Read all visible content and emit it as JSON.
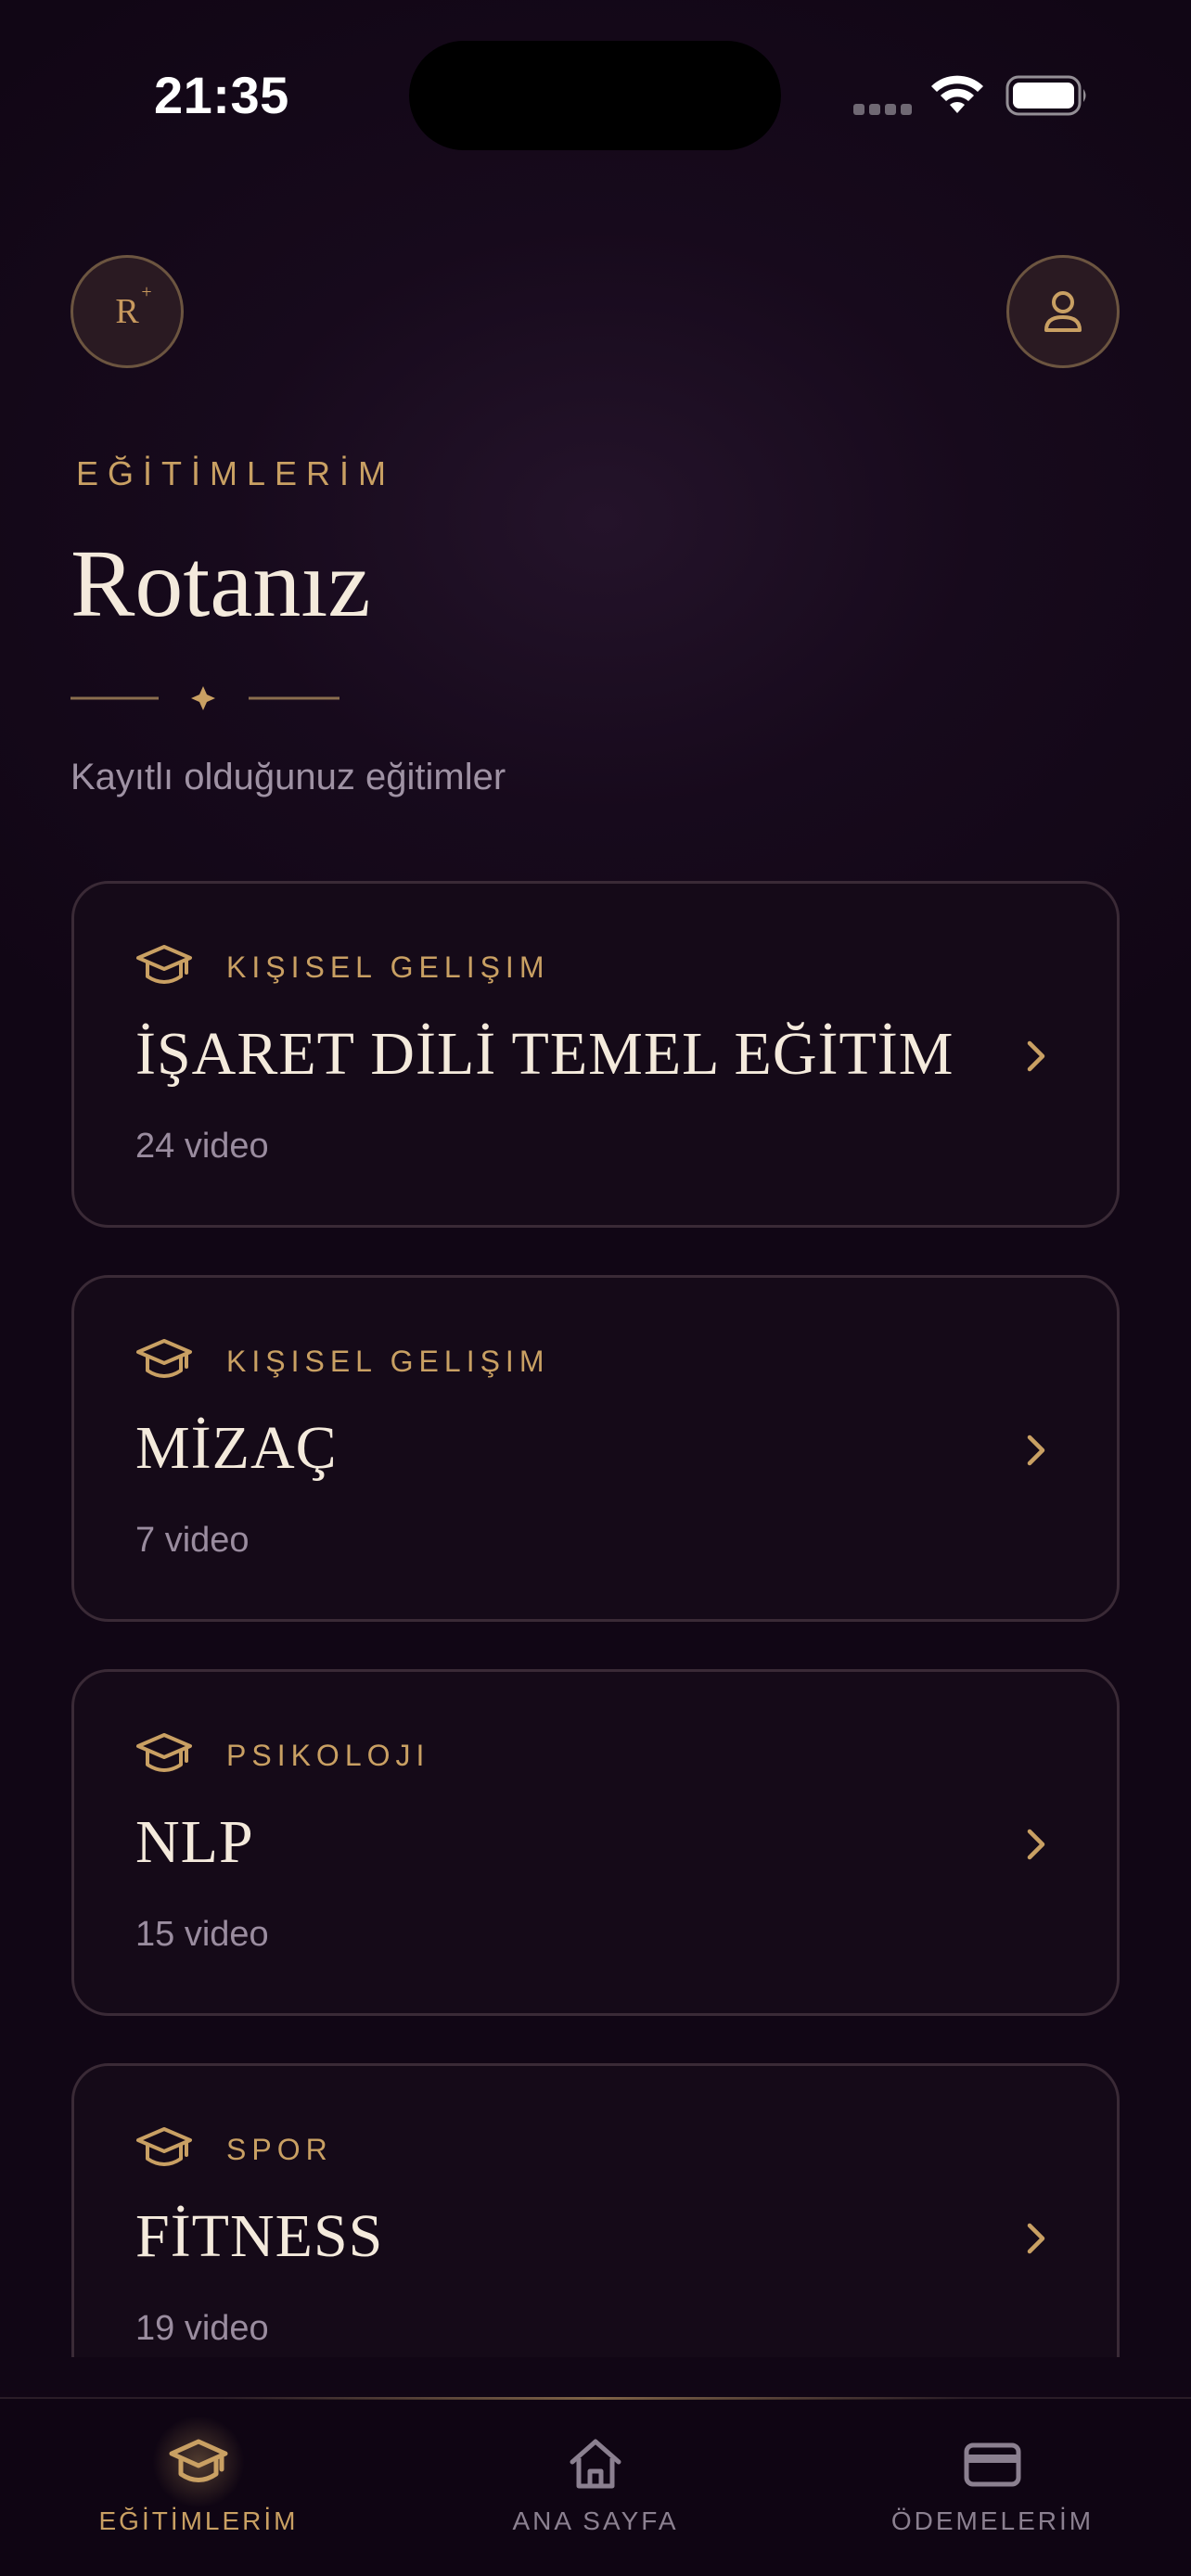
{
  "status_bar": {
    "time": "21:35"
  },
  "header": {
    "logo_letter": "R",
    "logo_mark": "+",
    "section_label": "EĞİTİMLERİM",
    "title": "Rotanız",
    "subtitle": "Kayıtlı olduğunuz eğitimler"
  },
  "courses": [
    {
      "category": "KIŞISEL GELIŞIM",
      "title": "İŞARET DİLİ TEMEL EĞİTİM",
      "count": "24 video"
    },
    {
      "category": "KIŞISEL GELIŞIM",
      "title": "MİZAÇ",
      "count": "7 video"
    },
    {
      "category": "PSIKOLOJI",
      "title": "NLP",
      "count": "15 video"
    },
    {
      "category": "SPOR",
      "title": "FİTNESS",
      "count": "19 video"
    }
  ],
  "tabbar": {
    "tabs": [
      {
        "label": "EĞİTİMLERİM",
        "icon": "graduation-cap-icon",
        "active": true
      },
      {
        "label": "ANA SAYFA",
        "icon": "home-icon",
        "active": false
      },
      {
        "label": "ÖDEMELERİM",
        "icon": "credit-card-icon",
        "active": false
      }
    ]
  },
  "colors": {
    "background": "#120716",
    "accent_gold": "#c9a063",
    "text_light": "#f4eadc",
    "text_muted": "#9a8c9f",
    "card_border": "#3a2a36"
  }
}
